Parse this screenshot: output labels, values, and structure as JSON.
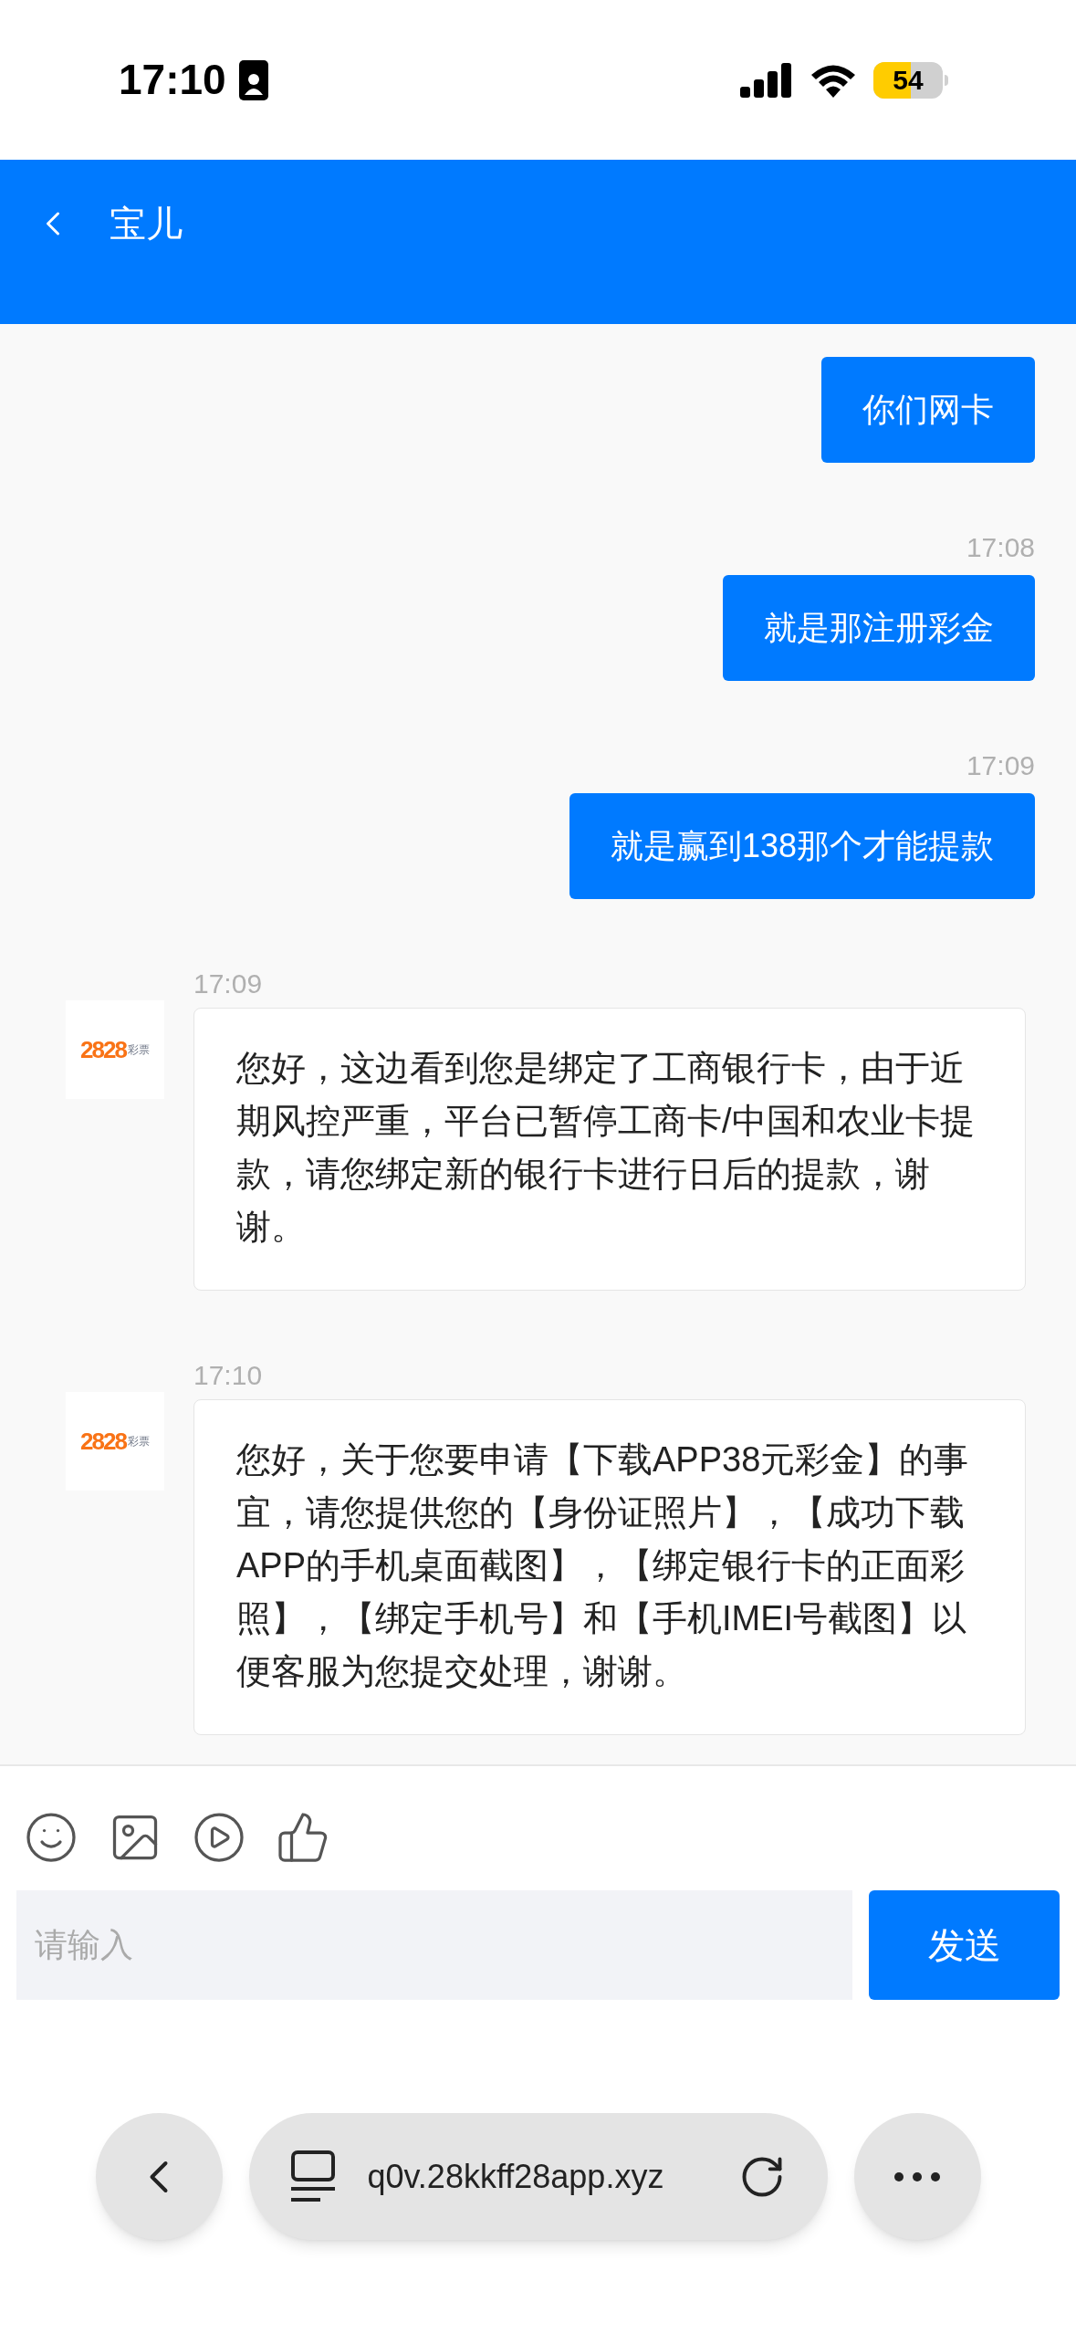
{
  "status_bar": {
    "time": "17:10",
    "battery": "54"
  },
  "header": {
    "title": "宝儿"
  },
  "messages": [
    {
      "kind": "sent",
      "text": "你们网卡"
    },
    {
      "kind": "sent",
      "time": "17:08",
      "text": "就是那注册彩金"
    },
    {
      "kind": "sent",
      "time": "17:09",
      "text": "就是赢到138那个才能提款"
    },
    {
      "kind": "received",
      "time": "17:09",
      "avatar": {
        "logo": "2828",
        "label": "彩票"
      },
      "text": "您好，这边看到您是绑定了工商银行卡，由于近期风控严重，平台已暂停工商卡/中国和农业卡提款，请您绑定新的银行卡进行日后的提款，谢谢。"
    },
    {
      "kind": "received",
      "time": "17:10",
      "avatar": {
        "logo": "2828",
        "label": "彩票"
      },
      "text": "您好，关于您要申请【下载APP38元彩金】的事宜，请您提供您的【身份证照片】，【成功下载APP的手机桌面截图】，【绑定银行卡的正面彩照】，【绑定手机号】和【手机IMEI号截图】以便客服为您提交处理，谢谢。"
    }
  ],
  "composer": {
    "placeholder": "请输入",
    "send": "发送"
  },
  "browser_bar": {
    "url": "q0v.28kkff28app.xyz"
  }
}
